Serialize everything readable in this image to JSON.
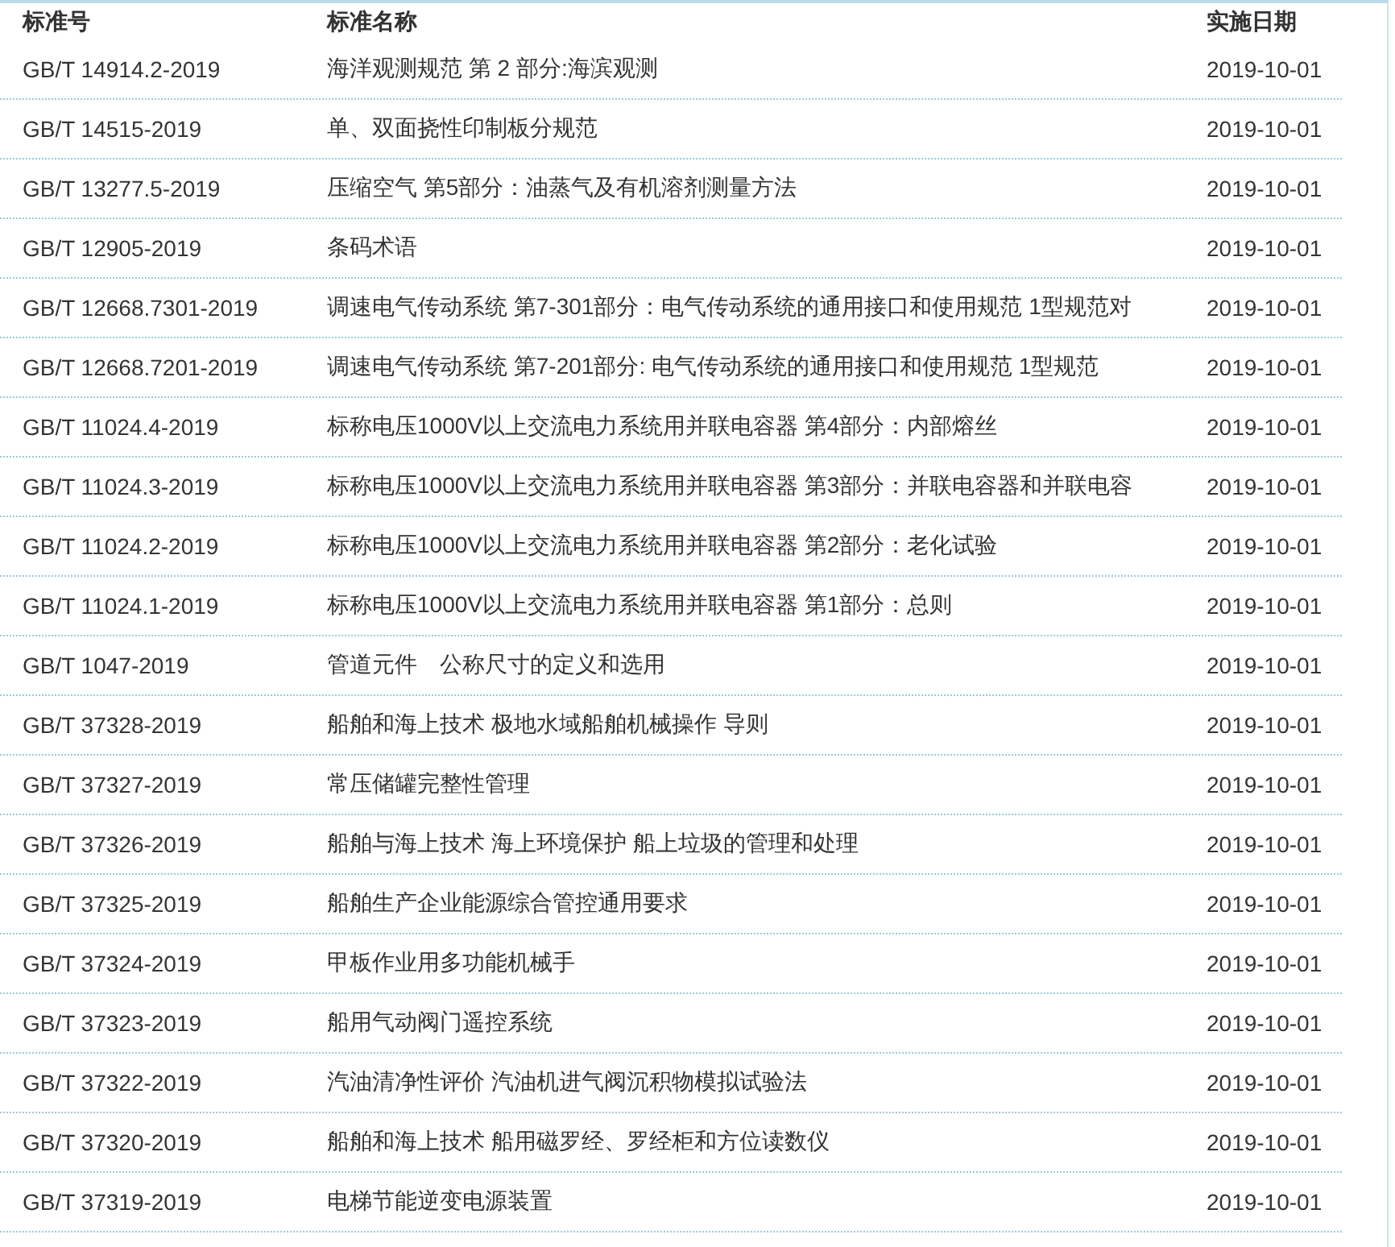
{
  "table": {
    "columns": [
      "标准号",
      "标准名称",
      "实施日期"
    ],
    "rows": [
      {
        "code": "GB/T 14914.2-2019",
        "name": "海洋观测规范 第 2 部分:海滨观测",
        "date": "2019-10-01"
      },
      {
        "code": "GB/T 14515-2019",
        "name": "单、双面挠性印制板分规范",
        "date": "2019-10-01"
      },
      {
        "code": "GB/T 13277.5-2019",
        "name": "压缩空气 第5部分：油蒸气及有机溶剂测量方法",
        "date": "2019-10-01"
      },
      {
        "code": "GB/T 12905-2019",
        "name": "条码术语",
        "date": "2019-10-01"
      },
      {
        "code": "GB/T 12668.7301-2019",
        "name": "调速电气传动系统 第7-301部分：电气传动系统的通用接口和使用规范 1型规范对",
        "date": "2019-10-01"
      },
      {
        "code": "GB/T 12668.7201-2019",
        "name": "调速电气传动系统 第7-201部分: 电气传动系统的通用接口和使用规范 1型规范",
        "date": "2019-10-01"
      },
      {
        "code": "GB/T 11024.4-2019",
        "name": "标称电压1000V以上交流电力系统用并联电容器 第4部分：内部熔丝",
        "date": "2019-10-01"
      },
      {
        "code": "GB/T 11024.3-2019",
        "name": "标称电压1000V以上交流电力系统用并联电容器 第3部分：并联电容器和并联电容",
        "date": "2019-10-01"
      },
      {
        "code": "GB/T 11024.2-2019",
        "name": "标称电压1000V以上交流电力系统用并联电容器 第2部分：老化试验",
        "date": "2019-10-01"
      },
      {
        "code": "GB/T 11024.1-2019",
        "name": "标称电压1000V以上交流电力系统用并联电容器 第1部分：总则",
        "date": "2019-10-01"
      },
      {
        "code": "GB/T 1047-2019",
        "name": "管道元件　公称尺寸的定义和选用",
        "date": "2019-10-01"
      },
      {
        "code": "GB/T 37328-2019",
        "name": "船舶和海上技术 极地水域船舶机械操作 导则",
        "date": "2019-10-01"
      },
      {
        "code": "GB/T 37327-2019",
        "name": "常压储罐完整性管理",
        "date": "2019-10-01"
      },
      {
        "code": "GB/T 37326-2019",
        "name": "船舶与海上技术 海上环境保护 船上垃圾的管理和处理",
        "date": "2019-10-01"
      },
      {
        "code": "GB/T 37325-2019",
        "name": "船舶生产企业能源综合管控通用要求",
        "date": "2019-10-01"
      },
      {
        "code": "GB/T 37324-2019",
        "name": "甲板作业用多功能机械手",
        "date": "2019-10-01"
      },
      {
        "code": "GB/T 37323-2019",
        "name": "船用气动阀门遥控系统",
        "date": "2019-10-01"
      },
      {
        "code": "GB/T 37322-2019",
        "name": "汽油清净性评价 汽油机进气阀沉积物模拟试验法",
        "date": "2019-10-01"
      },
      {
        "code": "GB/T 37320-2019",
        "name": "船舶和海上技术 船用磁罗经、罗经柜和方位读数仪",
        "date": "2019-10-01"
      },
      {
        "code": "GB/T 37319-2019",
        "name": "电梯节能逆变电源装置",
        "date": "2019-10-01"
      }
    ]
  }
}
